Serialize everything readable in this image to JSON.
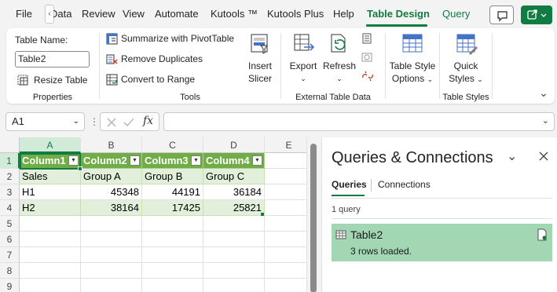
{
  "tabs": [
    "File",
    "Data",
    "Review",
    "View",
    "Automate",
    "Kutools ™",
    "Kutools Plus",
    "Help",
    "Table Design",
    "Query"
  ],
  "active_tab": "Table Design",
  "ribbon": {
    "properties": {
      "name_label": "Table Name:",
      "name_value": "Table2",
      "resize_label": "Resize Table",
      "group_label": "Properties"
    },
    "tools": {
      "pivot_label": "Summarize with PivotTable",
      "dupes_label": "Remove Duplicates",
      "convert_label": "Convert to Range",
      "slicer_label_1": "Insert",
      "slicer_label_2": "Slicer",
      "group_label": "Tools"
    },
    "external": {
      "export_label": "Export",
      "refresh_label": "Refresh",
      "group_label": "External Table Data"
    },
    "options": {
      "label_1": "Table Style",
      "label_2": "Options"
    },
    "styles": {
      "label_1": "Quick",
      "label_2": "Styles",
      "group_label": "Table Styles"
    }
  },
  "formula_bar": {
    "cell_ref": "A1",
    "fx": "fx",
    "formula": ""
  },
  "sheet": {
    "columns": [
      "A",
      "B",
      "C",
      "D",
      "E"
    ],
    "rows": [
      "1",
      "2",
      "3",
      "4",
      "5",
      "6",
      "7",
      "8",
      "9"
    ],
    "header": [
      "Column1",
      "Column2",
      "Column3",
      "Column4"
    ],
    "data": [
      [
        "Sales",
        "Group A",
        "Group B",
        "Group C"
      ],
      [
        "H1",
        "45348",
        "44191",
        "36184"
      ],
      [
        "H2",
        "38164",
        "17425",
        "25821"
      ]
    ]
  },
  "pane": {
    "title": "Queries & Connections",
    "tab_queries": "Queries",
    "tab_connections": "Connections",
    "count": "1 query",
    "query_name": "Table2",
    "query_status": "3 rows loaded."
  },
  "colors": {
    "accent": "#107c41",
    "table_header": "#70ad47",
    "table_band": "#e2efda",
    "query_highlight": "#a3d7b4"
  }
}
